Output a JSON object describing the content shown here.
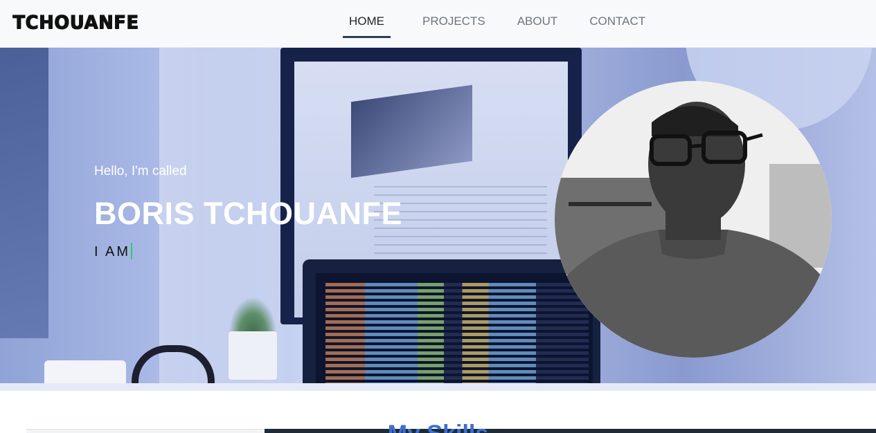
{
  "brand": {
    "text": "TCHOUANFE"
  },
  "nav": {
    "items": [
      {
        "label": "HOME",
        "active": true
      },
      {
        "label": "PROJECTS",
        "active": false
      },
      {
        "label": "ABOUT",
        "active": false
      },
      {
        "label": "CONTACT",
        "active": false
      }
    ]
  },
  "hero": {
    "greeting": "Hello, I'm called",
    "name": "BORIS TCHOUANFE",
    "typing_prefix": "I AM"
  },
  "skills": {
    "title": "My Skills"
  },
  "colors": {
    "nav_bg": "#f8f9fa",
    "active_underline": "#2c3e50",
    "cursor": "#2ecc71",
    "skills_title": "#3d6fd1"
  }
}
